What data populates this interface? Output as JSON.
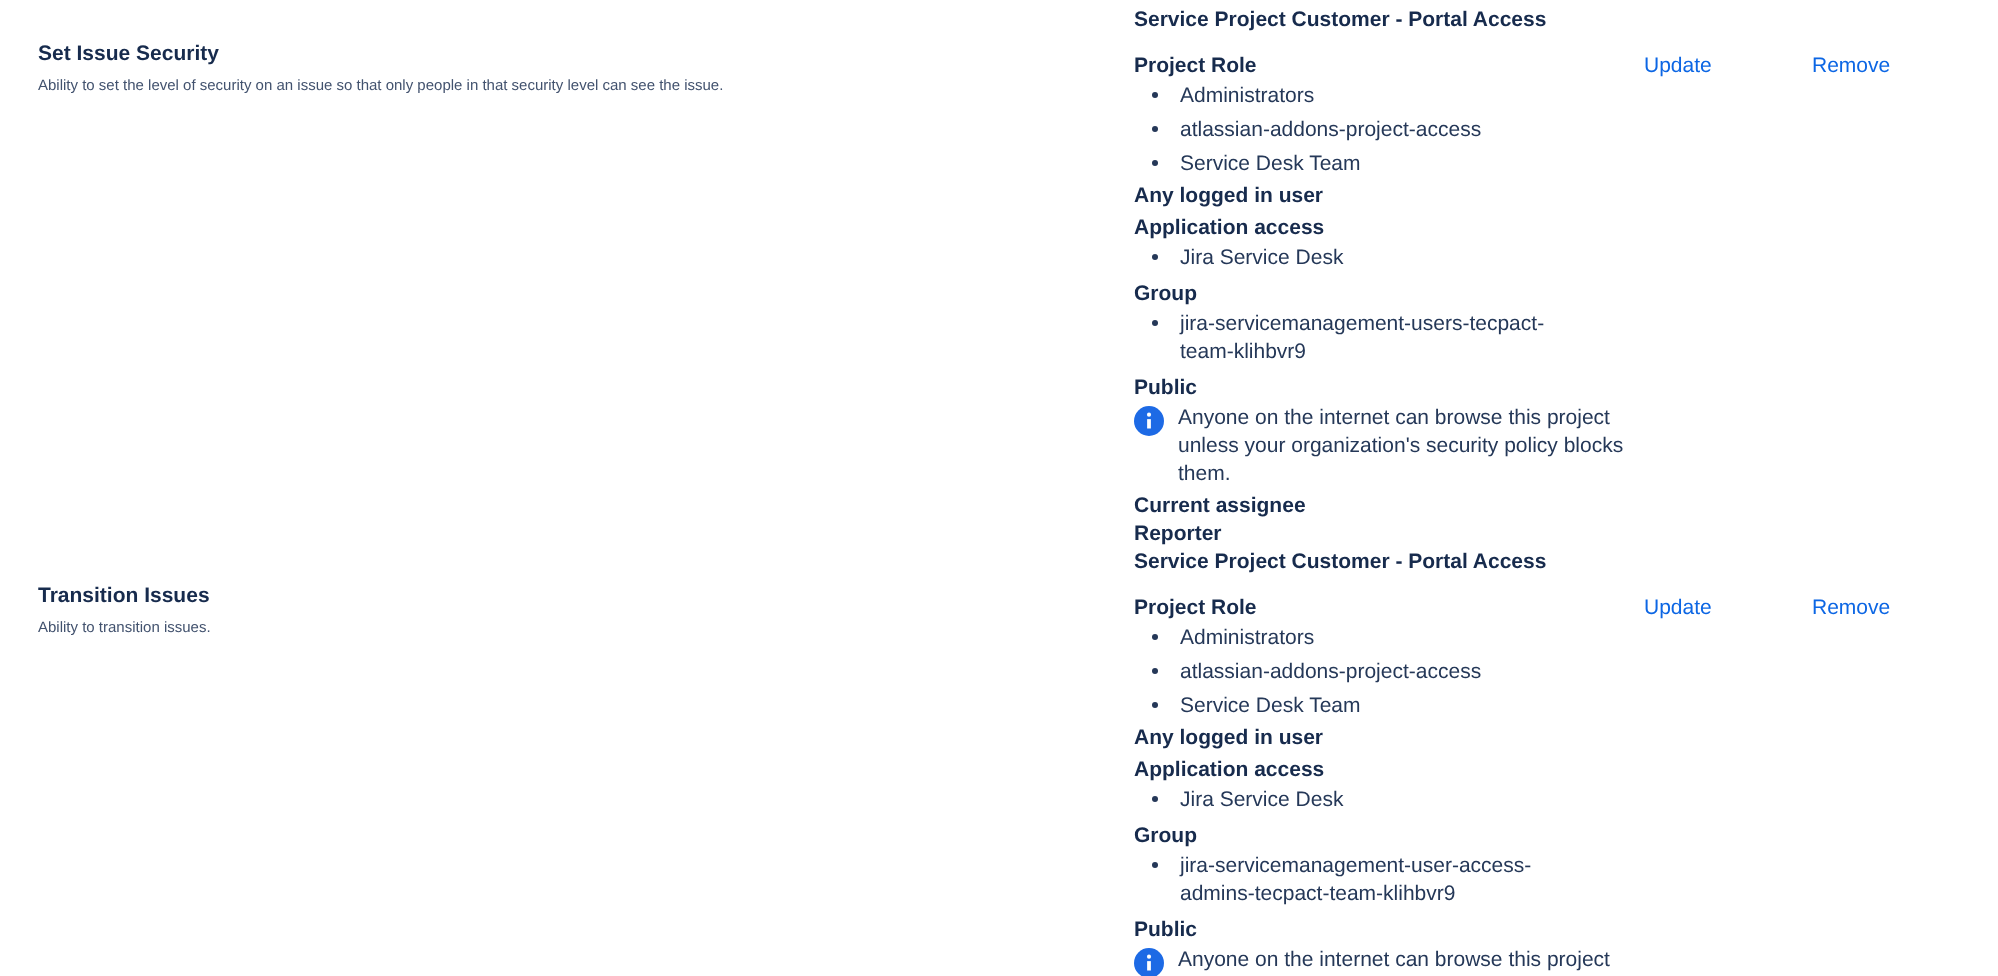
{
  "previous_row_tail": [
    "Service Project Customer - Portal Access"
  ],
  "permissions": [
    {
      "name": "Set Issue Security",
      "description": "Ability to set the level of security on an issue so that only people in that security level can see the issue.",
      "actions": [
        "Update",
        "Remove"
      ],
      "grantees": [
        {
          "kind": "heading",
          "text": "Project Role"
        },
        {
          "kind": "bullets",
          "items": [
            "Administrators",
            "atlassian-addons-project-access",
            "Service Desk Team"
          ]
        },
        {
          "kind": "label",
          "text": "Any logged in user"
        },
        {
          "kind": "heading",
          "text": "Application access"
        },
        {
          "kind": "bullets",
          "items": [
            "Jira Service Desk"
          ]
        },
        {
          "kind": "heading",
          "text": "Group"
        },
        {
          "kind": "bullets",
          "items": [
            "jira-servicemanagement-users-tecpact-team-klihbvr9"
          ]
        },
        {
          "kind": "heading",
          "text": "Public"
        },
        {
          "kind": "note",
          "text": "Anyone on the internet can browse this project unless your organization's security policy blocks them."
        },
        {
          "kind": "label",
          "text": "Current assignee"
        },
        {
          "kind": "label",
          "text": "Reporter"
        },
        {
          "kind": "label",
          "text": "Service Project Customer - Portal Access"
        }
      ]
    },
    {
      "name": "Transition Issues",
      "description": "Ability to transition issues.",
      "actions": [
        "Update",
        "Remove"
      ],
      "grantees": [
        {
          "kind": "heading",
          "text": "Project Role"
        },
        {
          "kind": "bullets",
          "items": [
            "Administrators",
            "atlassian-addons-project-access",
            "Service Desk Team"
          ]
        },
        {
          "kind": "label",
          "text": "Any logged in user"
        },
        {
          "kind": "heading",
          "text": "Application access"
        },
        {
          "kind": "bullets",
          "items": [
            "Jira Service Desk"
          ]
        },
        {
          "kind": "heading",
          "text": "Group"
        },
        {
          "kind": "bullets",
          "items": [
            "jira-servicemanagement-user-access-admins-tecpact-team-klihbvr9"
          ]
        },
        {
          "kind": "heading",
          "text": "Public"
        },
        {
          "kind": "note",
          "text": "Anyone on the internet can browse this project"
        }
      ]
    }
  ]
}
